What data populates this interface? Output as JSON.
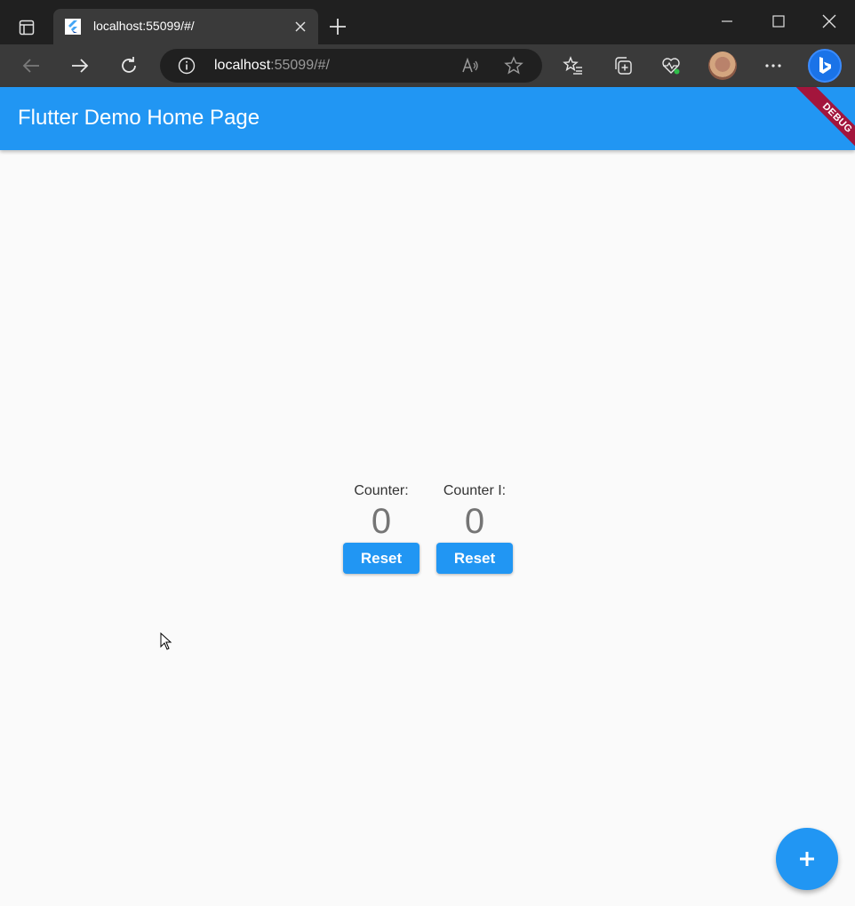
{
  "browser": {
    "tab": {
      "title": "localhost:55099/#/"
    },
    "address": {
      "host": "localhost",
      "rest": ":55099/#/"
    }
  },
  "app": {
    "title": "Flutter Demo Home Page",
    "debug_banner": "DEBUG",
    "counters": [
      {
        "label": "Counter:",
        "value": "0",
        "button": "Reset"
      },
      {
        "label": "Counter I:",
        "value": "0",
        "button": "Reset"
      }
    ]
  },
  "colors": {
    "primary": "#2196f3",
    "debug": "#a3153c",
    "background": "#fafafa"
  },
  "icons": {
    "fab": "plus-icon"
  }
}
